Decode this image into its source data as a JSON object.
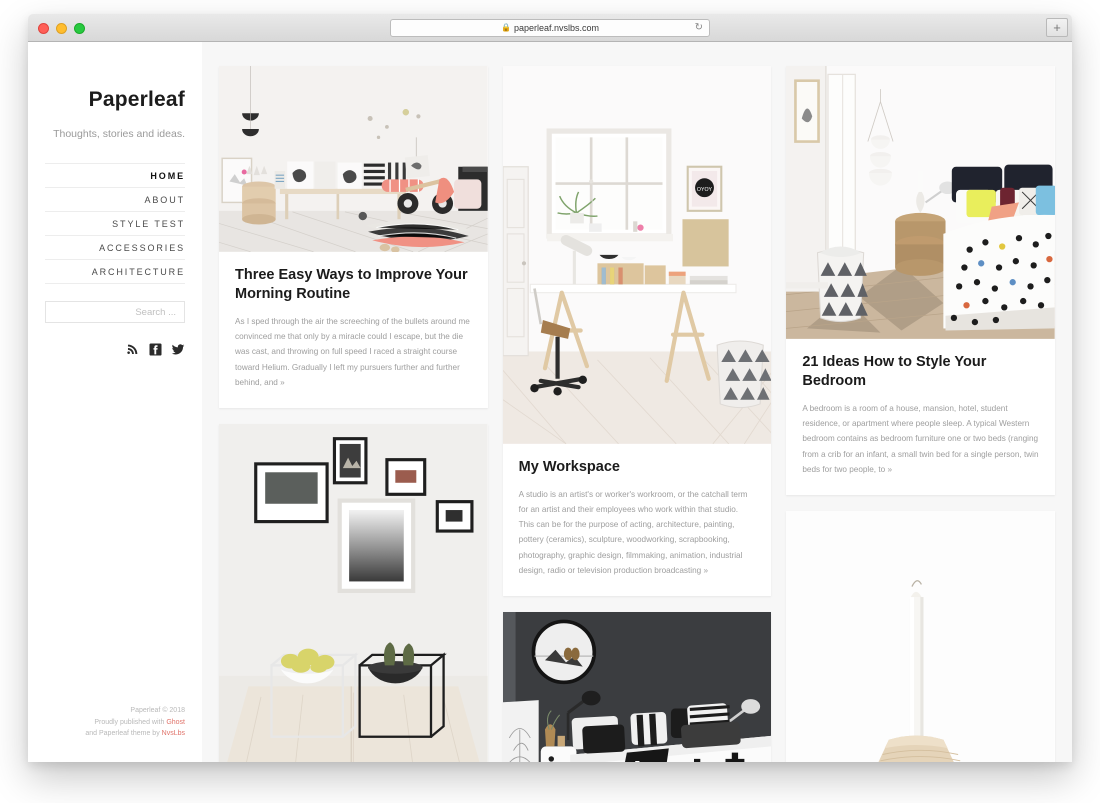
{
  "browser": {
    "url": "paperleaf.nvslbs.com",
    "lock_icon": "lock-icon",
    "reload_icon": "reload-icon",
    "newtab_label": "+",
    "traffic_lights": [
      "close",
      "minimize",
      "maximize"
    ]
  },
  "sidebar": {
    "title": "Paperleaf",
    "tagline": "Thoughts, stories and ideas.",
    "nav": [
      {
        "label": "HOME",
        "active": true
      },
      {
        "label": "ABOUT",
        "active": false
      },
      {
        "label": "STYLE TEST",
        "active": false
      },
      {
        "label": "ACCESSORIES",
        "active": false
      },
      {
        "label": "ARCHITECTURE",
        "active": false
      }
    ],
    "search": {
      "placeholder": "Search ...",
      "value": ""
    },
    "social": [
      {
        "name": "rss-icon",
        "label": "RSS"
      },
      {
        "name": "facebook-icon",
        "label": "Facebook"
      },
      {
        "name": "twitter-icon",
        "label": "Twitter"
      }
    ],
    "footer": {
      "line1": "Paperleaf © 2018",
      "line2_prefix": "Proudly published with ",
      "line2_link": "Ghost",
      "line3_prefix": "and Paperleaf theme by ",
      "line3_link": "NvsLbs"
    }
  },
  "posts": {
    "column1": [
      {
        "image_name": "scandinavian-living-room-photo",
        "title": "Three Easy Ways to Improve Your Morning Routine",
        "excerpt": "As I sped through the air the screeching of the bullets around me convinced me that only by a miracle could I escape, but the die was cast, and throwing on full speed I raced a straight course toward Helium. Gradually I left my pursuers further and further behind, and »"
      },
      {
        "image_name": "gallery-wall-fruit-bowls-photo",
        "title": "",
        "excerpt": ""
      }
    ],
    "column2": [
      {
        "image_name": "white-workspace-desk-photo",
        "title": "My Workspace",
        "excerpt": "A studio is an artist's or worker's workroom, or the catchall term for an artist and their employees who work within that studio. This can be for the purpose of acting, architecture, painting, pottery (ceramics), sculpture, woodworking, scrapbooking, photography, graphic design, filmmaking, animation, industrial design, radio or television production broadcasting »"
      },
      {
        "image_name": "dark-bedroom-monochrome-photo",
        "title": "",
        "excerpt": ""
      }
    ],
    "column3": [
      {
        "image_name": "bright-bedroom-polka-dots-photo",
        "title": "21 Ideas How to Style Your Bedroom",
        "excerpt": "A bedroom is a room of a house, mansion, hotel, student residence, or apartment where people sleep. A typical Western bedroom contains as bedroom furniture one or two beds (ranging from a crib for an infant, a small twin bed for a single person, twin beds for two people, to »"
      },
      {
        "image_name": "wooden-candle-holder-photo",
        "title": "",
        "excerpt": ""
      }
    ]
  },
  "colors": {
    "page_background": "#f7f7f7",
    "card_background": "#ffffff",
    "text_primary": "#1b1b1b",
    "text_muted": "#9e9e9e",
    "footer_link": "#e0736a",
    "divider": "#ededed"
  }
}
